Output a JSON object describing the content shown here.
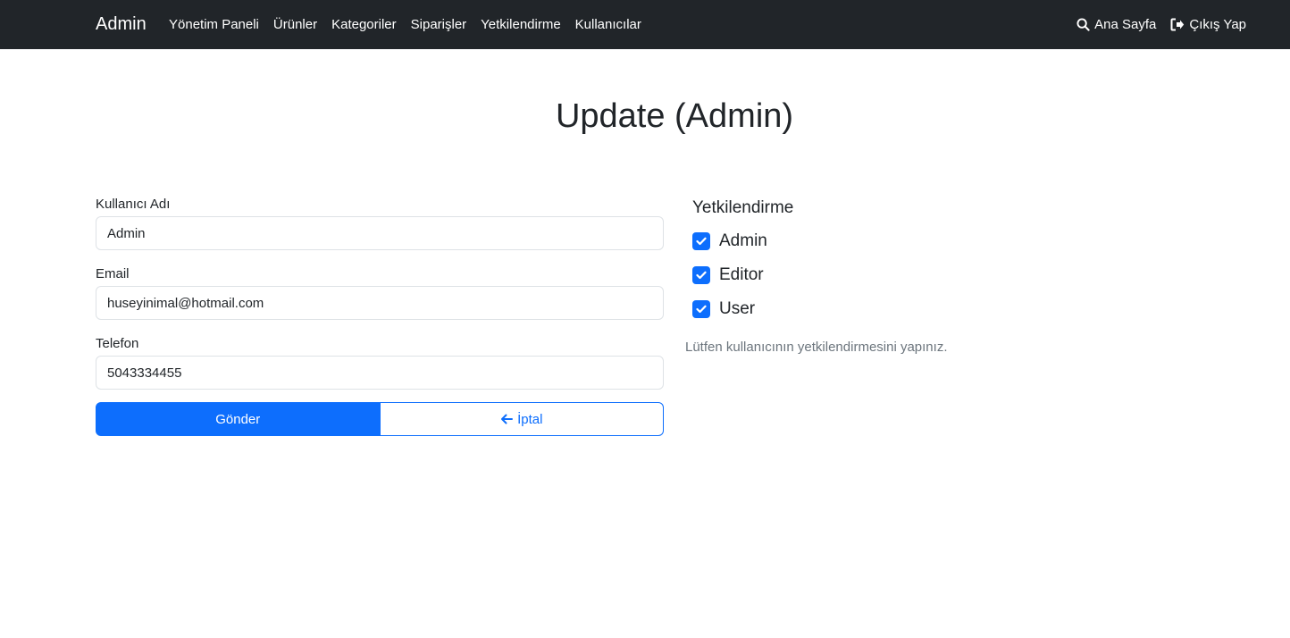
{
  "navbar": {
    "brand": "Admin",
    "links": [
      "Yönetim Paneli",
      "Ürünler",
      "Kategoriler",
      "Siparişler",
      "Yetkilendirme",
      "Kullanıcılar"
    ],
    "right": {
      "home": {
        "label": "Ana Sayfa",
        "icon": "search-icon"
      },
      "logout": {
        "label": "Çıkış Yap",
        "icon": "sign-out-icon"
      }
    }
  },
  "page": {
    "title": "Update (Admin)"
  },
  "form": {
    "username": {
      "label": "Kullanıcı Adı",
      "value": "Admin"
    },
    "email": {
      "label": "Email",
      "value": "huseyinimal@hotmail.com"
    },
    "phone": {
      "label": "Telefon",
      "value": "5043334455"
    },
    "submit_label": "Gönder",
    "cancel_label": "İptal",
    "cancel_icon": "arrow-left-icon"
  },
  "permissions": {
    "title": "Yetkilendirme",
    "roles": [
      {
        "label": "Admin",
        "checked": true
      },
      {
        "label": "Editor",
        "checked": true
      },
      {
        "label": "User",
        "checked": true
      }
    ],
    "help": "Lütfen kullanıcının yetkilendirmesini yapınız."
  },
  "colors": {
    "navbar": "#212529",
    "primary": "#0d6efd",
    "muted": "#6c757d"
  }
}
